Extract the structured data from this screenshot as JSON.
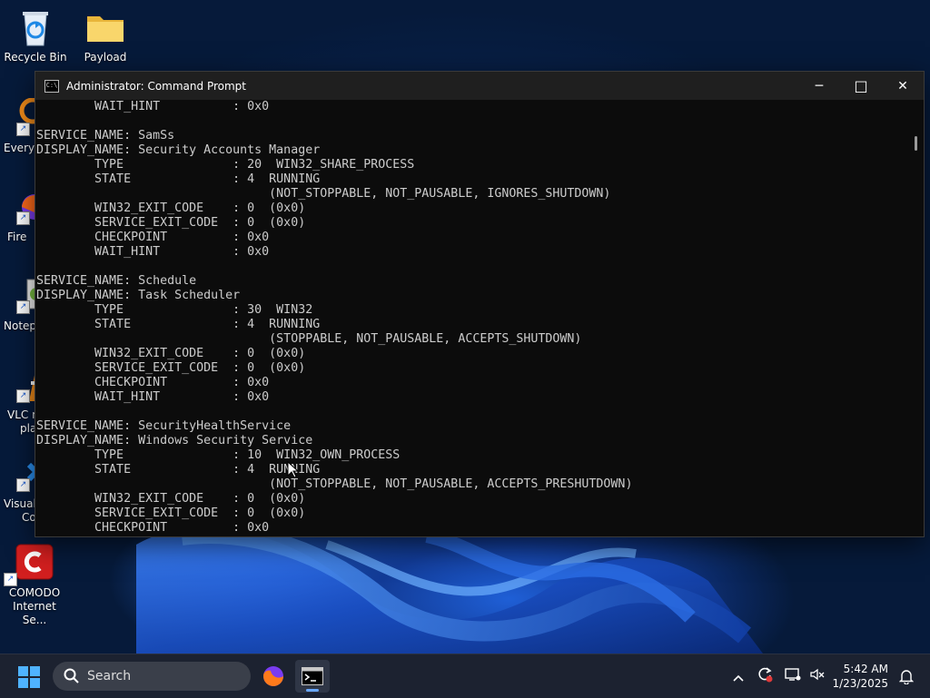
{
  "desktop": {
    "icons": [
      {
        "label": "Recycle Bin"
      },
      {
        "label": "Payload"
      },
      {
        "label": "Every"
      },
      {
        "label": "Fire"
      },
      {
        "label": "Notep"
      },
      {
        "label": "VLC m",
        "label2": "pla"
      },
      {
        "label": "Visual",
        "label2": "Co"
      },
      {
        "label": "COMODO",
        "label2": "Internet Se..."
      }
    ]
  },
  "window": {
    "title": "Administrator: Command Prompt",
    "minimize": "─",
    "maximize": "□",
    "close": "✕",
    "lines": [
      "        WAIT_HINT          : 0x0",
      "",
      "SERVICE_NAME: SamSs",
      "DISPLAY_NAME: Security Accounts Manager",
      "        TYPE               : 20  WIN32_SHARE_PROCESS",
      "        STATE              : 4  RUNNING",
      "                                (NOT_STOPPABLE, NOT_PAUSABLE, IGNORES_SHUTDOWN)",
      "        WIN32_EXIT_CODE    : 0  (0x0)",
      "        SERVICE_EXIT_CODE  : 0  (0x0)",
      "        CHECKPOINT         : 0x0",
      "        WAIT_HINT          : 0x0",
      "",
      "SERVICE_NAME: Schedule",
      "DISPLAY_NAME: Task Scheduler",
      "        TYPE               : 30  WIN32",
      "        STATE              : 4  RUNNING",
      "                                (STOPPABLE, NOT_PAUSABLE, ACCEPTS_SHUTDOWN)",
      "        WIN32_EXIT_CODE    : 0  (0x0)",
      "        SERVICE_EXIT_CODE  : 0  (0x0)",
      "        CHECKPOINT         : 0x0",
      "        WAIT_HINT          : 0x0",
      "",
      "SERVICE_NAME: SecurityHealthService",
      "DISPLAY_NAME: Windows Security Service",
      "        TYPE               : 10  WIN32_OWN_PROCESS",
      "        STATE              : 4  RUNNING",
      "                                (NOT_STOPPABLE, NOT_PAUSABLE, ACCEPTS_PRESHUTDOWN)",
      "        WIN32_EXIT_CODE    : 0  (0x0)",
      "        SERVICE_EXIT_CODE  : 0  (0x0)",
      "        CHECKPOINT         : 0x0"
    ]
  },
  "taskbar": {
    "search_placeholder": "Search",
    "apps": [
      "firefox-icon",
      "command-prompt-icon"
    ],
    "tray": [
      "chevron-up-icon",
      "sync-error-icon",
      "network-icon",
      "volume-muted-icon"
    ],
    "time": "5:42 AM",
    "date": "1/23/2025",
    "accent": "#6aa8ff"
  }
}
